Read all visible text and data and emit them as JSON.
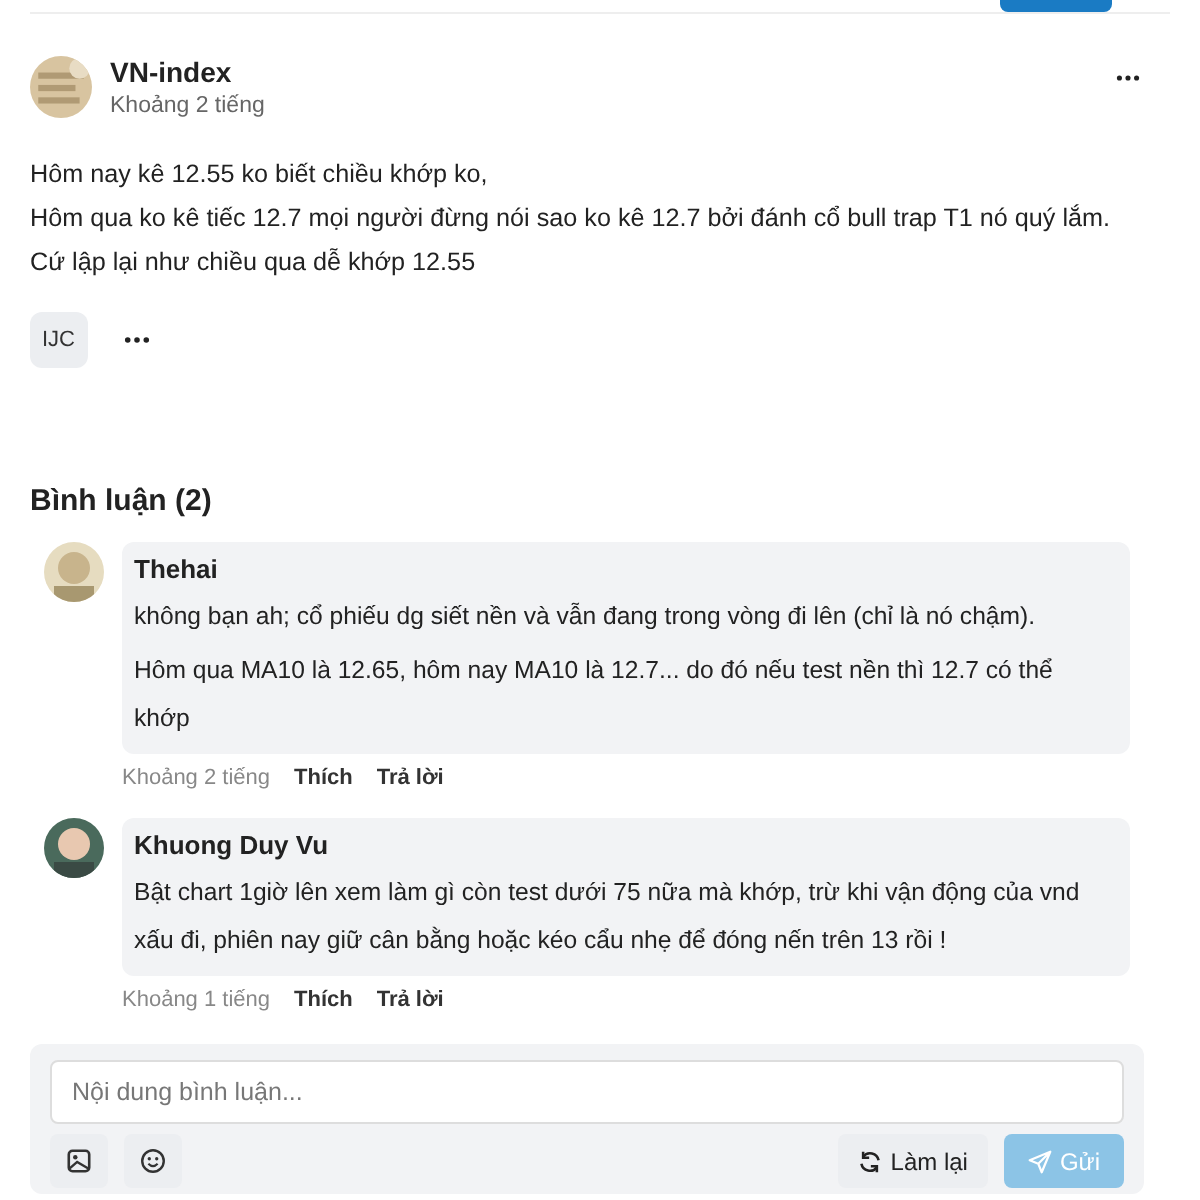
{
  "post": {
    "author": "VN-index",
    "time": "Khoảng 2 tiếng",
    "lines": [
      "Hôm nay kê 12.55 ko biết chiều khớp ko,",
      "Hôm qua ko kê tiếc 12.7 mọi người đừng nói sao ko kê 12.7 bởi đánh cổ bull trap T1 nó quý lắm.",
      "Cứ lập lại như chiều qua dễ khớp 12.55"
    ],
    "tags": [
      "IJC"
    ]
  },
  "comments_title": "Bình luận (2)",
  "comments": [
    {
      "author": "Thehai",
      "paragraphs": [
        "không bạn ah; cổ phiếu dg siết nền và vẫn đang trong vòng đi lên (chỉ là nó chậm).",
        "Hôm qua MA10 là 12.65, hôm nay MA10 là 12.7... do đó nếu test nền thì 12.7 có thể khớp"
      ],
      "time": "Khoảng 2 tiếng",
      "like": "Thích",
      "reply": "Trả lời"
    },
    {
      "author": "Khuong Duy Vu",
      "paragraphs": [
        "Bật chart 1giờ lên xem làm gì còn test dưới 75 nữa mà khớp, trừ khi vận động của vnd xấu đi, phiên nay giữ cân bằng hoặc kéo cẩu nhẹ để đóng nến trên 13 rồi !"
      ],
      "time": "Khoảng 1 tiếng",
      "like": "Thích",
      "reply": "Trả lời"
    }
  ],
  "composer": {
    "placeholder": "Nội dung bình luận...",
    "reset": "Làm lại",
    "send": {
      "label": "Gửi",
      "disabled": true
    }
  }
}
